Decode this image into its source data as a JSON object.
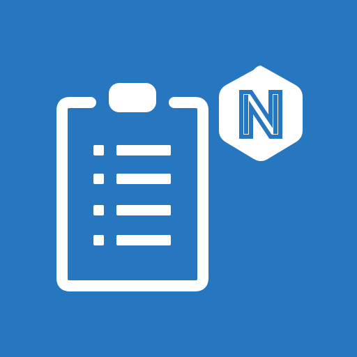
{
  "icon": {
    "background_color": "#2677BF",
    "foreground_color": "#FFFFFF",
    "clipboard_icon": "clipboard-checklist-icon",
    "badge_icon": "hexagon-n-logo-icon",
    "badge_letter": "N",
    "checklist_item_count": 4
  }
}
